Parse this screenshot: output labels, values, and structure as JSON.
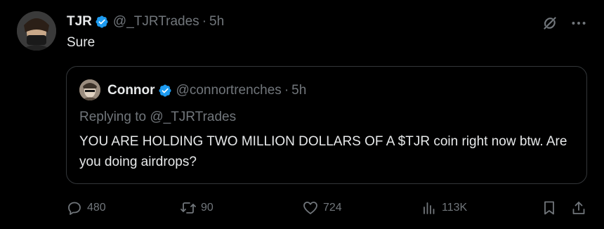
{
  "tweet": {
    "author_name": "TJR",
    "handle": "@_TJRTrades",
    "dot": "·",
    "time": "5h",
    "text": "Sure"
  },
  "quote": {
    "author_name": "Connor",
    "handle": "@connortrenches",
    "dot": "·",
    "time": "5h",
    "replying_prefix": "Replying to ",
    "replying_to": "@_TJRTrades",
    "text": "YOU ARE HOLDING TWO MILLION DOLLARS OF A $TJR coin right now btw. Are you doing airdrops?"
  },
  "actions": {
    "replies": "480",
    "reposts": "90",
    "likes": "724",
    "views": "113K"
  },
  "icons": {
    "verified": "verified-badge-icon",
    "grok": "grok-icon",
    "more": "more-icon",
    "reply": "reply-icon",
    "repost": "repost-icon",
    "like": "heart-icon",
    "views": "views-icon",
    "bookmark": "bookmark-icon",
    "share": "share-icon"
  },
  "colors": {
    "background": "#000000",
    "text": "#e7e9ea",
    "muted": "#71767b",
    "verified": "#1d9bf0",
    "border": "#333639"
  }
}
